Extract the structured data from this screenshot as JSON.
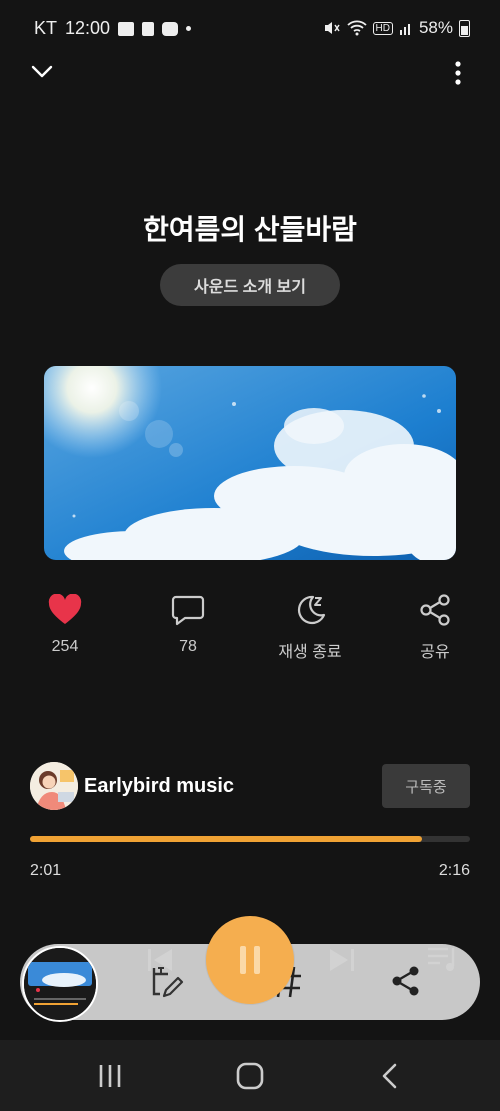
{
  "status_bar": {
    "carrier": "KT",
    "time": "12:00",
    "battery": "58%",
    "hd": "HD"
  },
  "track": {
    "title": "한여름의 산들바람",
    "intro_button": "사운드 소개 보기"
  },
  "actions": [
    {
      "label": "254",
      "icon": "heart-icon"
    },
    {
      "label": "78",
      "icon": "comment-icon"
    },
    {
      "label": "재생 종료",
      "icon": "sleep-timer-icon"
    },
    {
      "label": "공유",
      "icon": "share-icon"
    }
  ],
  "channel": {
    "name": "Earlybird music",
    "subscribe_label": "구독중"
  },
  "playback": {
    "current_time": "2:01",
    "total_time": "2:16",
    "progress": 0.89
  },
  "colors": {
    "accent": "#f0a234",
    "play_button": "#f5ae4f",
    "like": "#e8344a"
  }
}
